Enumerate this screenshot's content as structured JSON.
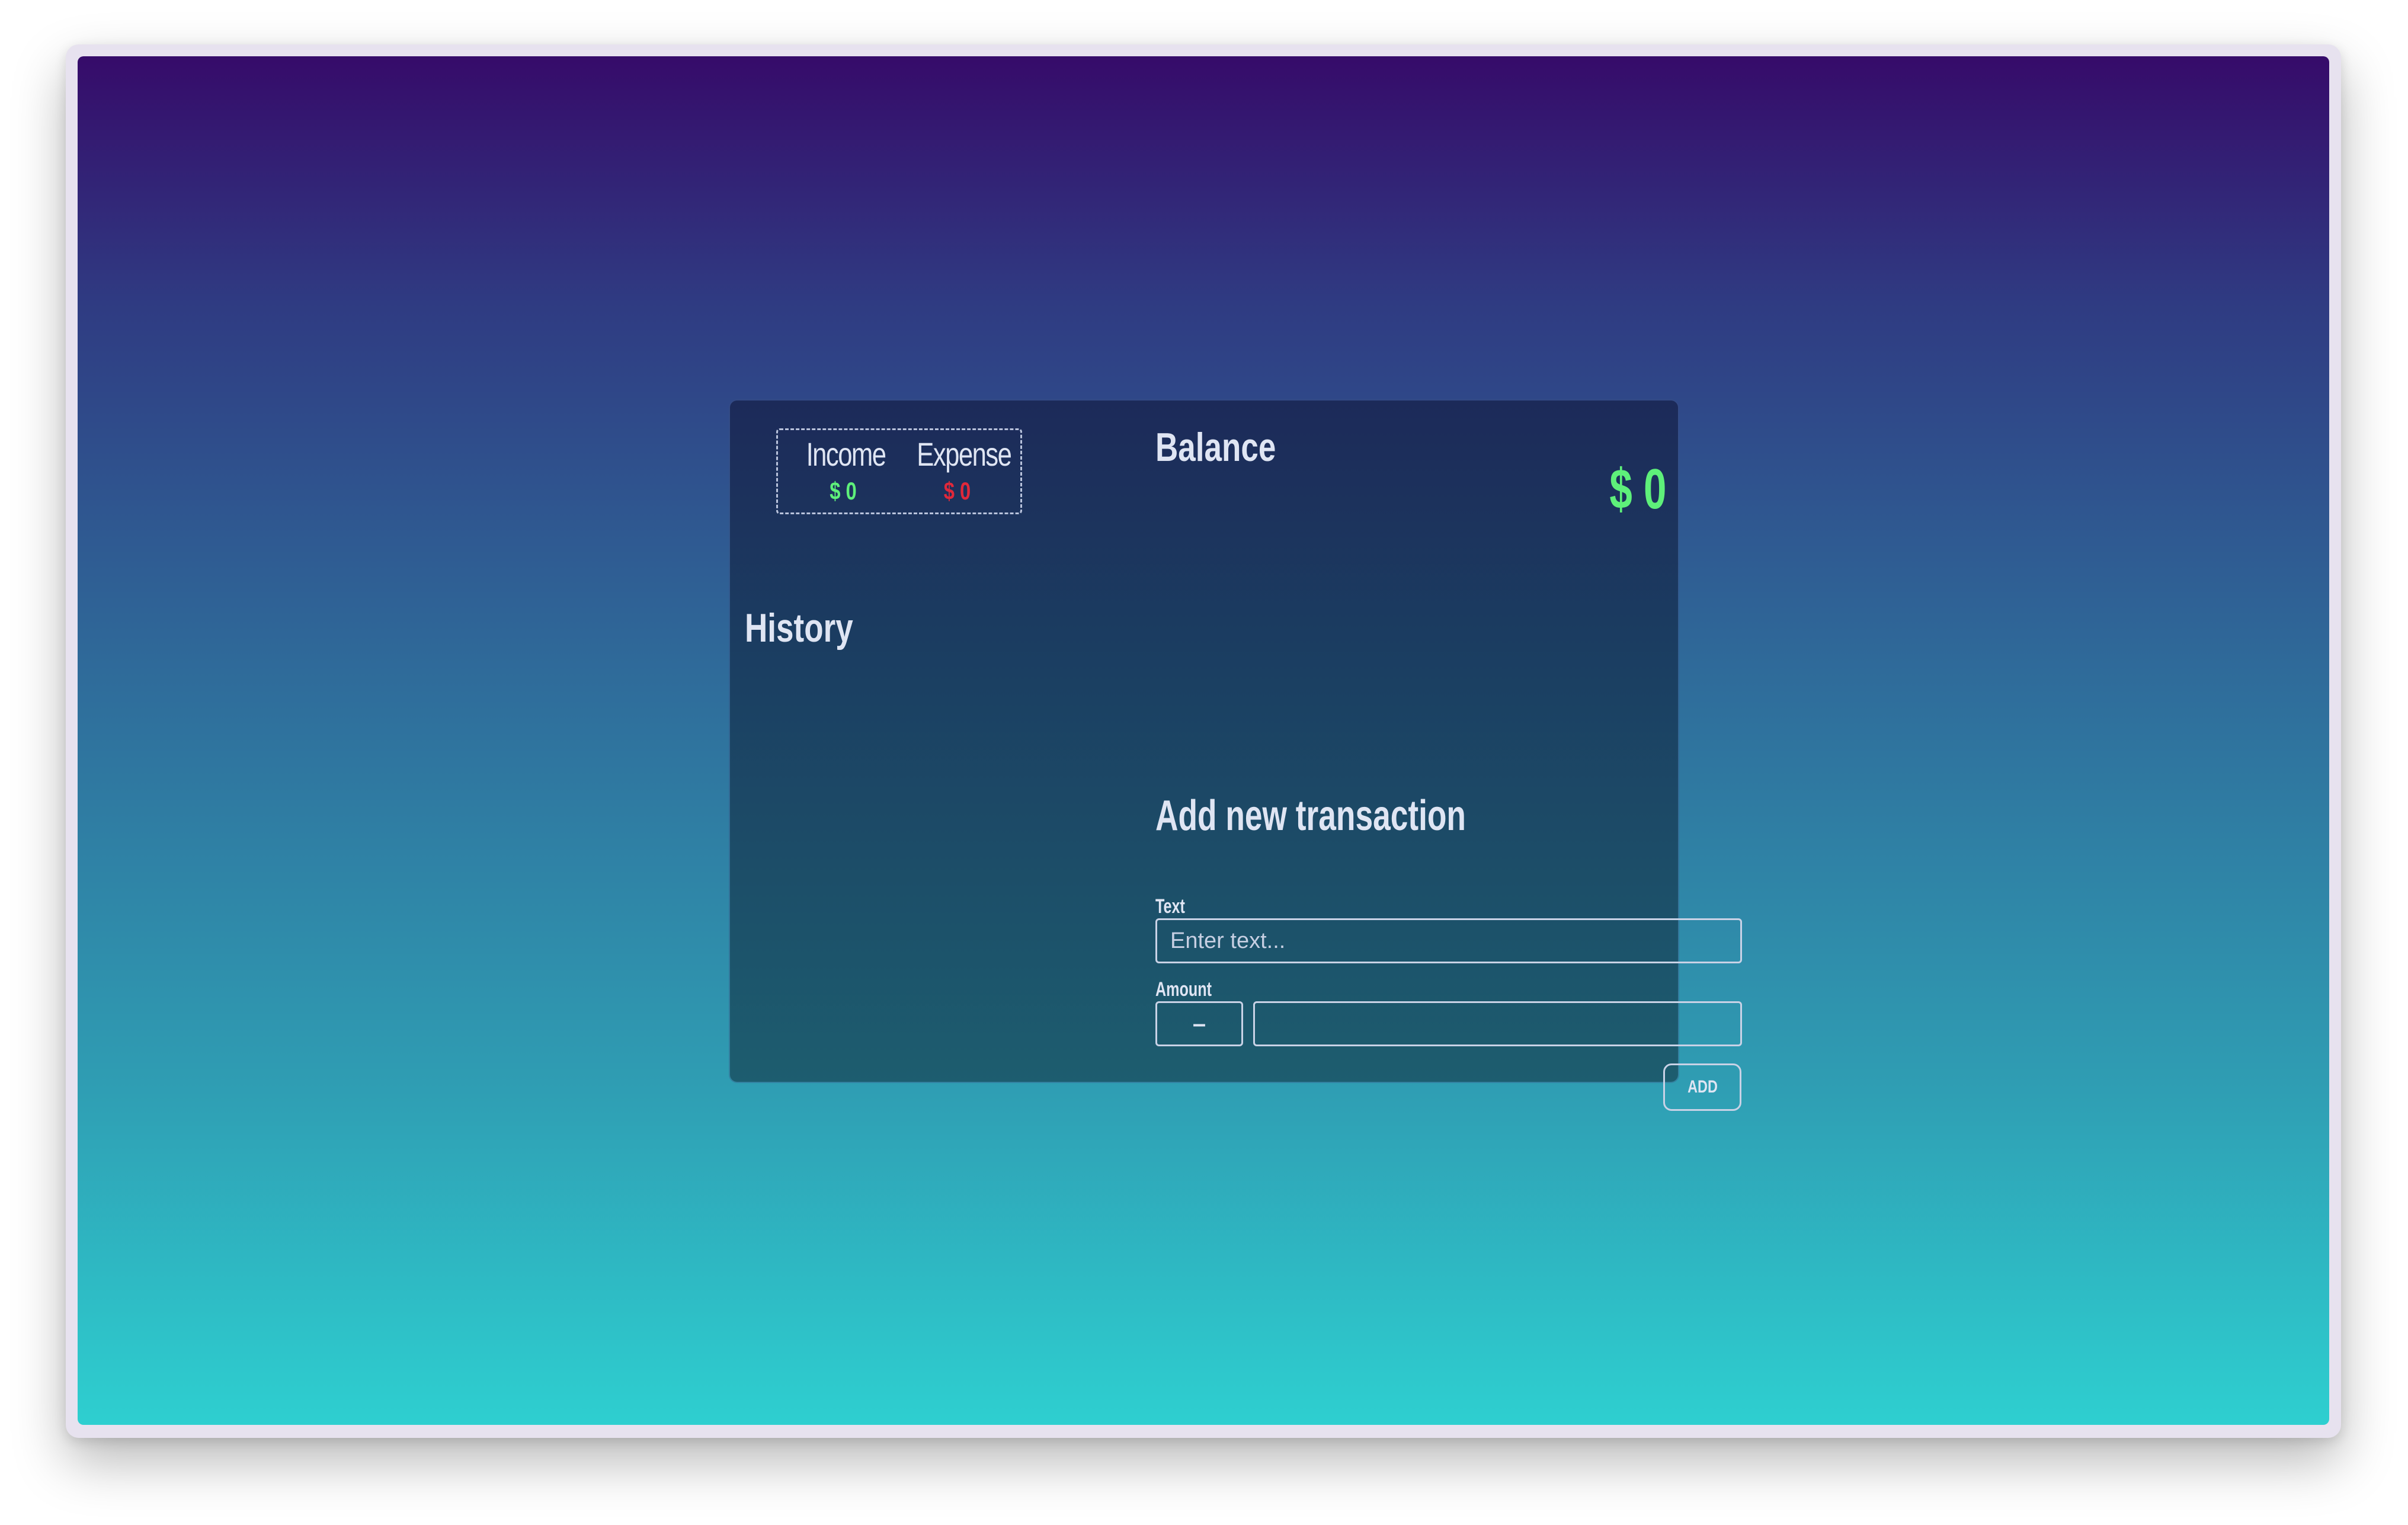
{
  "summary": {
    "income_label": "Income",
    "income_value": "$ 0",
    "expense_label": "Expense",
    "expense_value": "$ 0"
  },
  "balance": {
    "title": "Balance",
    "value": "$ 0"
  },
  "history": {
    "title": "History"
  },
  "form": {
    "title": "Add new transaction",
    "text_label": "Text",
    "text_placeholder": "Enter text...",
    "text_value": "",
    "amount_label": "Amount",
    "sign_label": "–",
    "amount_value": "",
    "add_label": "ADD"
  },
  "colors": {
    "positive": "#5ef07a",
    "negative": "#e0283a"
  }
}
